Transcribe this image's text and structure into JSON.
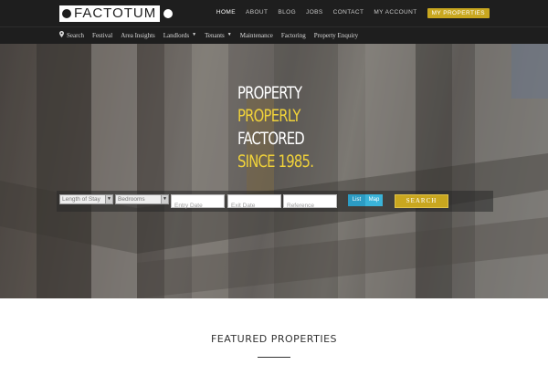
{
  "brand": {
    "name": "FACTOTUM"
  },
  "main_nav": [
    {
      "label": "HOME",
      "active": true
    },
    {
      "label": "ABOUT",
      "active": false
    },
    {
      "label": "BLOG",
      "active": false
    },
    {
      "label": "JOBS",
      "active": false
    },
    {
      "label": "CONTACT",
      "active": false
    },
    {
      "label": "MY ACCOUNT",
      "active": false
    }
  ],
  "my_properties_label": "MY PROPERTIES",
  "sub_nav": [
    {
      "label": "Search",
      "icon": "map-pin-icon",
      "dropdown": false
    },
    {
      "label": "Festival",
      "dropdown": false
    },
    {
      "label": "Area Insights",
      "dropdown": false
    },
    {
      "label": "Landlords",
      "dropdown": true
    },
    {
      "label": "Tenants",
      "dropdown": true
    },
    {
      "label": "Maintenance",
      "dropdown": false
    },
    {
      "label": "Factoring",
      "dropdown": false
    },
    {
      "label": "Property Enquiry",
      "dropdown": false
    }
  ],
  "hero": {
    "lines": [
      {
        "text": "PROPERTY",
        "color": "white"
      },
      {
        "text": "PROPERLY",
        "color": "gold"
      },
      {
        "text": "FACTORED",
        "color": "white"
      },
      {
        "text": "SINCE 1985.",
        "color": "gold"
      }
    ]
  },
  "search": {
    "length_of_stay": "Length of Stay",
    "bedrooms": "Bedrooms",
    "entry_date_placeholder": "Entry Date",
    "exit_date_placeholder": "Exit Date",
    "reference_placeholder": "Reference",
    "view_list": "List",
    "view_map": "Map",
    "button_label": "SEARCH"
  },
  "featured": {
    "title": "FEATURED PROPERTIES"
  },
  "colors": {
    "accent_gold": "#c9a71f",
    "headline_gold": "#f0d23a",
    "bar_dark": "#1e1e1e",
    "toggle_blue": "#3ab3d8"
  }
}
